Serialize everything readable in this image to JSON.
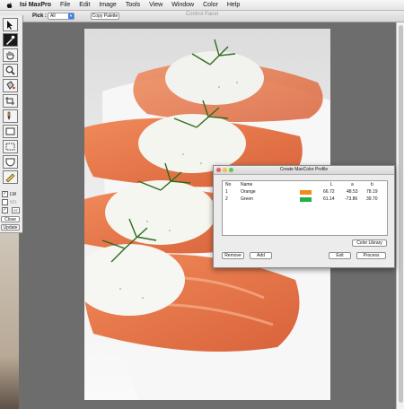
{
  "menubar": {
    "app_name": "Isi MaxPro",
    "items": [
      "File",
      "Edit",
      "Image",
      "Tools",
      "View",
      "Window",
      "Color",
      "Help"
    ]
  },
  "toolbar": {
    "panel_title": "Control Panel",
    "pick_label": "Pick :",
    "pick_value": "All",
    "copy_palette": "Copy Palette"
  },
  "tools": {
    "lw_label": "LW",
    "ms_label": "MS",
    "input_value": "07",
    "close_label": "Close",
    "update_label": "Update"
  },
  "dialog": {
    "title": "Create MaxColor Profile",
    "columns": [
      "No",
      "Name",
      "",
      "L",
      "a",
      "b"
    ],
    "rows": [
      {
        "no": "1",
        "name": "Orange",
        "color": "#f4891b",
        "L": "66.72",
        "a": "48.53",
        "b": "78.19"
      },
      {
        "no": "2",
        "name": "Green",
        "color": "#1fb04a",
        "L": "61.14",
        "a": "-73.86",
        "b": "39.70"
      }
    ],
    "buttons": {
      "color_library": "Color Library",
      "remove": "Remove",
      "add": "Add",
      "exit": "Exit",
      "process": "Process"
    }
  },
  "colors": {
    "close_dot": "#ed5f57",
    "min_dot": "#f6bf4f",
    "max_dot": "#5fc84c"
  }
}
